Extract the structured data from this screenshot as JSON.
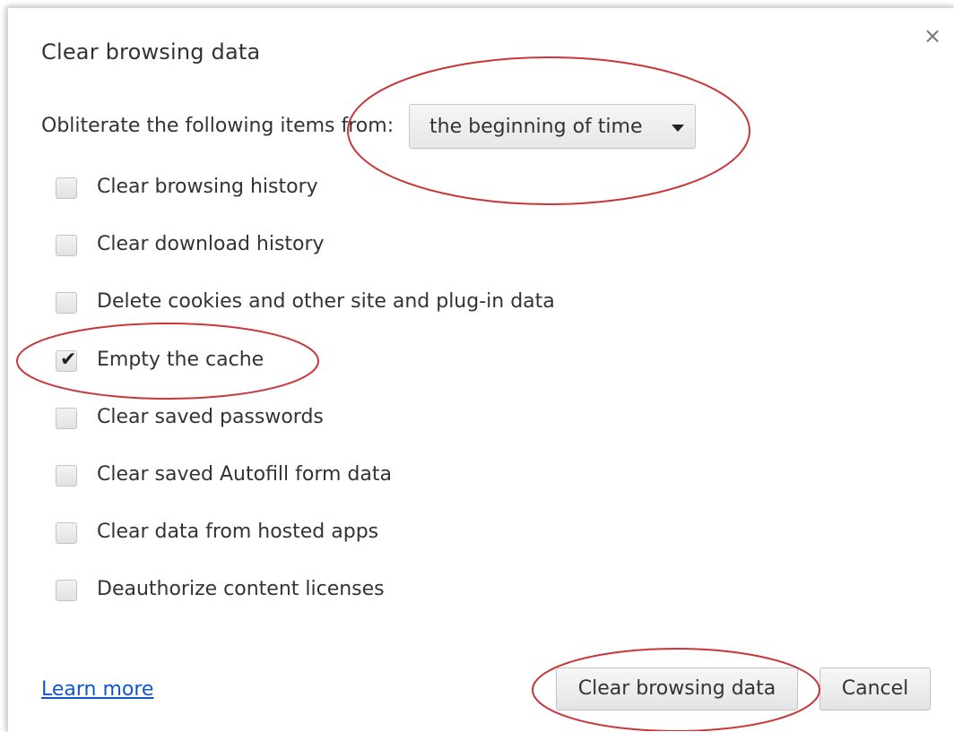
{
  "dialog": {
    "title": "Clear browsing data",
    "close_glyph": "×"
  },
  "period": {
    "label": "Obliterate the following items from:",
    "selected": "the beginning of time"
  },
  "items": [
    {
      "label": "Clear browsing history",
      "checked": false
    },
    {
      "label": "Clear download history",
      "checked": false
    },
    {
      "label": "Delete cookies and other site and plug-in data",
      "checked": false
    },
    {
      "label": "Empty the cache",
      "checked": true
    },
    {
      "label": "Clear saved passwords",
      "checked": false
    },
    {
      "label": "Clear saved Autofill form data",
      "checked": false
    },
    {
      "label": "Clear data from hosted apps",
      "checked": false
    },
    {
      "label": "Deauthorize content licenses",
      "checked": false
    }
  ],
  "footer": {
    "learn_more": "Learn more",
    "clear_button": "Clear browsing data",
    "cancel_button": "Cancel"
  },
  "colors": {
    "annotation": "#c8363a",
    "link": "#1155cc"
  }
}
